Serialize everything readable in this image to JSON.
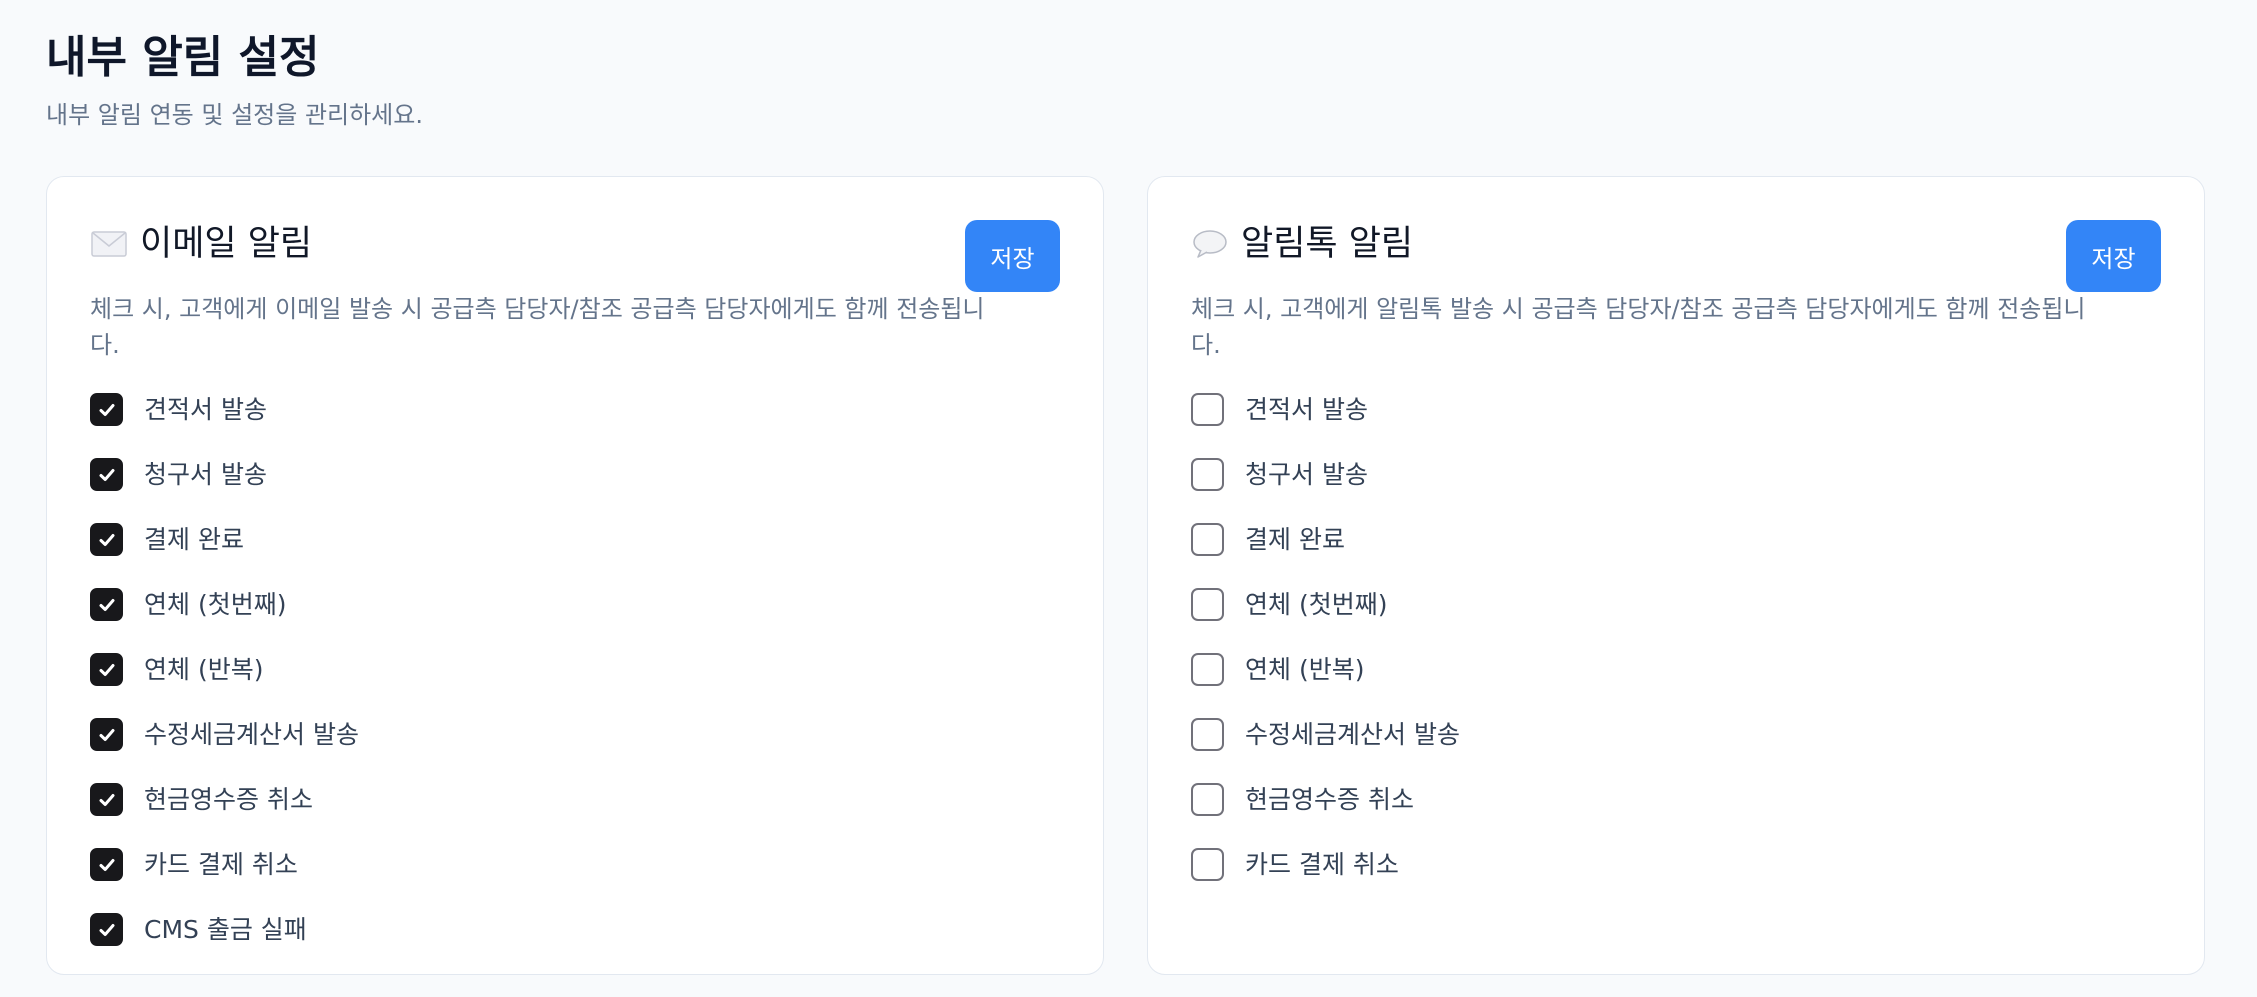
{
  "page": {
    "title": "내부 알림 설정",
    "subtitle": "내부 알림 연동 및 설정을 관리하세요."
  },
  "email_card": {
    "icon": "envelope-icon",
    "title": "이메일 알림",
    "description": "체크 시, 고객에게 이메일 발송 시 공급측 담당자/참조 공급측 담당자에게도 함께 전송됩니다.",
    "save_label": "저장",
    "options": [
      {
        "label": "견적서 발송",
        "checked": true
      },
      {
        "label": "청구서 발송",
        "checked": true
      },
      {
        "label": "결제 완료",
        "checked": true
      },
      {
        "label": "연체 (첫번째)",
        "checked": true
      },
      {
        "label": "연체 (반복)",
        "checked": true
      },
      {
        "label": "수정세금계산서 발송",
        "checked": true
      },
      {
        "label": "현금영수증 취소",
        "checked": true
      },
      {
        "label": "카드 결제 취소",
        "checked": true
      },
      {
        "label": "CMS 출금 실패",
        "checked": true
      }
    ]
  },
  "alimtalk_card": {
    "icon": "speech-bubble-icon",
    "title": "알림톡 알림",
    "description": "체크 시, 고객에게 알림톡 발송 시 공급측 담당자/참조 공급측 담당자에게도 함께 전송됩니다.",
    "save_label": "저장",
    "options": [
      {
        "label": "견적서 발송",
        "checked": false
      },
      {
        "label": "청구서 발송",
        "checked": false
      },
      {
        "label": "결제 완료",
        "checked": false
      },
      {
        "label": "연체 (첫번째)",
        "checked": false
      },
      {
        "label": "연체 (반복)",
        "checked": false
      },
      {
        "label": "수정세금계산서 발송",
        "checked": false
      },
      {
        "label": "현금영수증 취소",
        "checked": false
      },
      {
        "label": "카드 결제 취소",
        "checked": false
      }
    ]
  },
  "colors": {
    "accent": "#3385f7",
    "checked": "#18181b",
    "background": "#f8fafc"
  }
}
